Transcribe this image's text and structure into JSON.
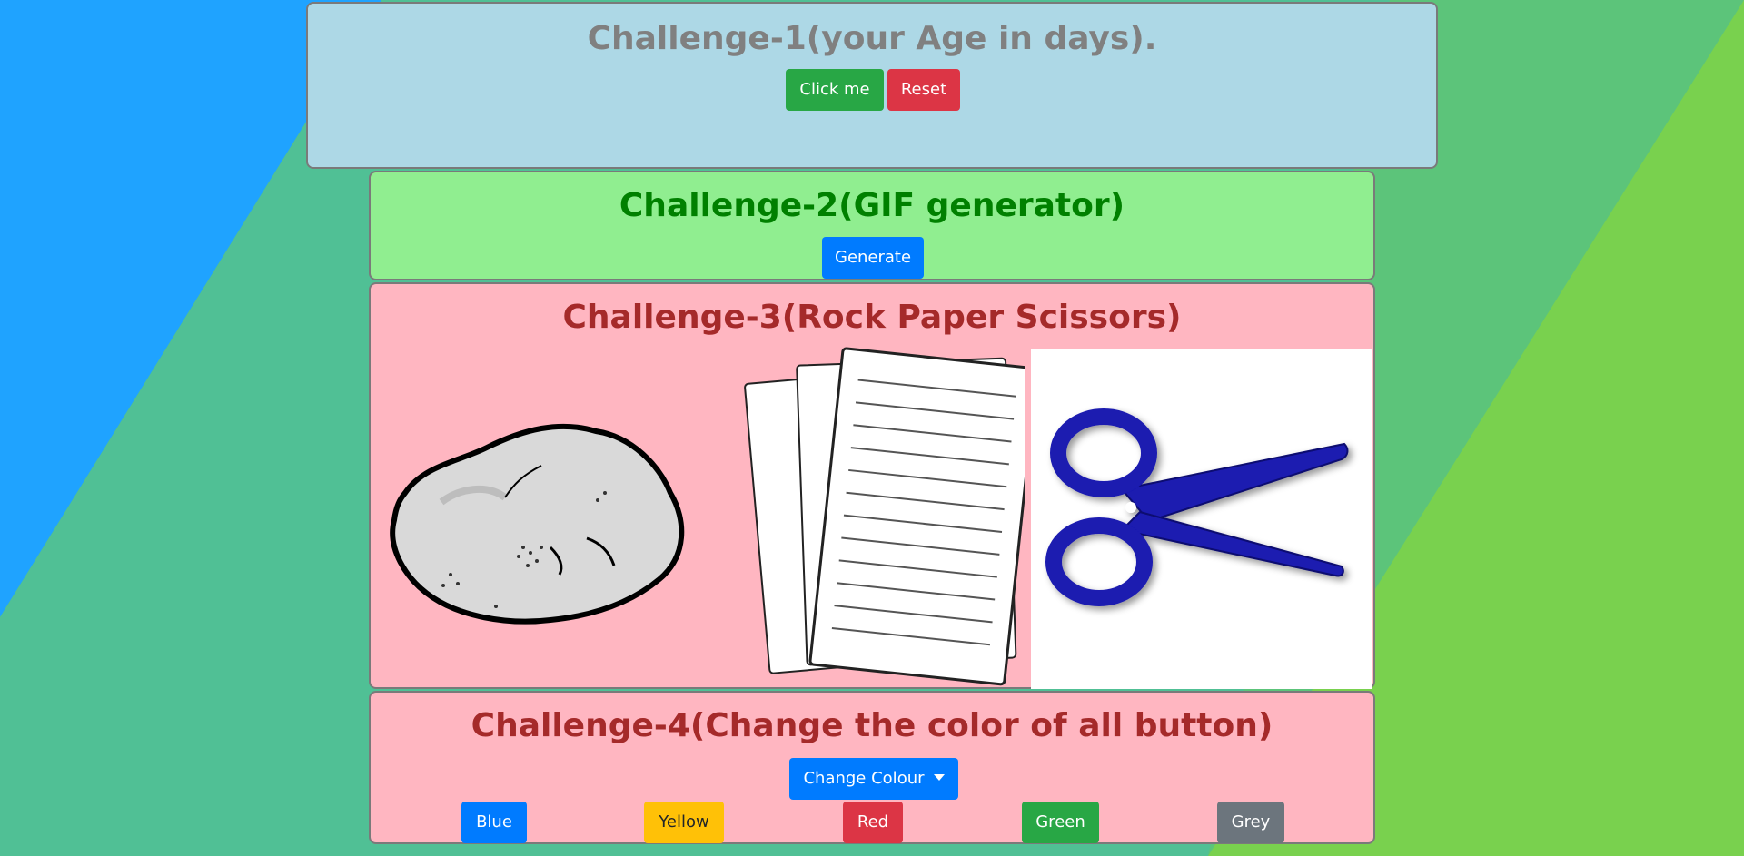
{
  "colors": {
    "bg_blue": "#1fa3ff",
    "bg_teal": "#4fbf9a",
    "bg_green": "#5bc47a",
    "bg_lime": "#79d14e",
    "card1": "#add8e6",
    "card2": "#90ee90",
    "card3": "#ffb6c1",
    "title1": "#808080",
    "title2": "#008000",
    "title3": "#a52a2a"
  },
  "challenge1": {
    "title": "Challenge-1(your Age in days).",
    "click_label": "Click me",
    "reset_label": "Reset"
  },
  "challenge2": {
    "title": "Challenge-2(GIF generator)",
    "generate_label": "Generate"
  },
  "challenge3": {
    "title": "Challenge-3(Rock Paper Scissors)",
    "choices": [
      "rock-image",
      "paper-image",
      "scissors-image"
    ]
  },
  "challenge4": {
    "title": "Challenge-4(Change the color of all button)",
    "dropdown_label": "Change Colour",
    "buttons": [
      {
        "label": "Blue"
      },
      {
        "label": "Yellow"
      },
      {
        "label": "Red"
      },
      {
        "label": "Green"
      },
      {
        "label": "Grey"
      }
    ]
  }
}
